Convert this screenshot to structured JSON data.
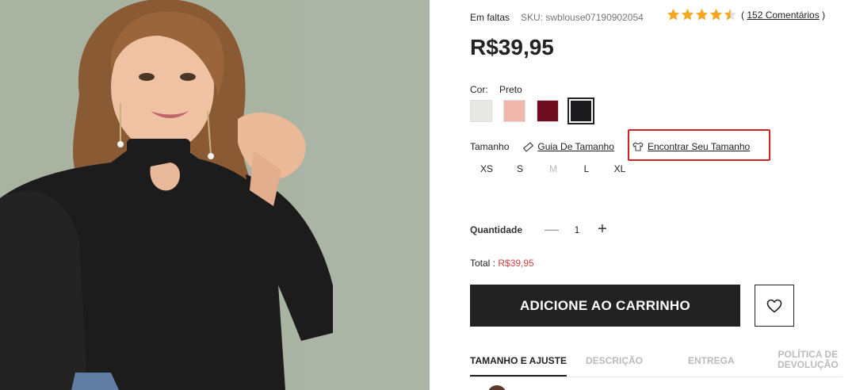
{
  "product": {
    "stock_status": "Em faltas",
    "sku": "SKU: swblouse07190902054",
    "rating_stars": 4.5,
    "reviews": {
      "open": "(",
      "text": "152 Comentários",
      "close": ")"
    },
    "price": "R$39,95"
  },
  "color": {
    "label": "Cor:",
    "selected": "Preto",
    "swatches": [
      {
        "name": "white",
        "hex": "#e9e7e3"
      },
      {
        "name": "pink",
        "hex": "#f0b8ac"
      },
      {
        "name": "burgundy",
        "hex": "#6e0b1e"
      },
      {
        "name": "black",
        "hex": "#1b1b1d",
        "selected": true
      }
    ]
  },
  "size": {
    "label": "Tamanho",
    "guide_link": "Guia De Tamanho",
    "finder_link": "Encontrar Seu Tamanho",
    "options": [
      {
        "label": "XS",
        "available": true
      },
      {
        "label": "S",
        "available": true
      },
      {
        "label": "M",
        "available": false
      },
      {
        "label": "L",
        "available": true
      },
      {
        "label": "XL",
        "available": true
      }
    ]
  },
  "quantity": {
    "label": "Quantidade",
    "minus": "—",
    "value": "1",
    "plus": "+"
  },
  "total": {
    "label": "Total : ",
    "amount": "R$39,95"
  },
  "actions": {
    "add_to_cart": "ADICIONE AO CARRINHO",
    "wishlist_icon": "heart-icon"
  },
  "tabs": [
    {
      "label": "TAMANHO E AJUSTE",
      "active": true
    },
    {
      "label": "DESCRIÇÃO",
      "active": false
    },
    {
      "label": "ENTREGA",
      "active": false
    },
    {
      "label_line1": "POLÍTICA DE",
      "label_line2": "DEVOLUÇÃO",
      "active": false
    }
  ],
  "colors": {
    "highlight_border": "#d12222",
    "button_dark": "#222222",
    "star": "#f5a623",
    "total_amount": "#cc4444"
  }
}
